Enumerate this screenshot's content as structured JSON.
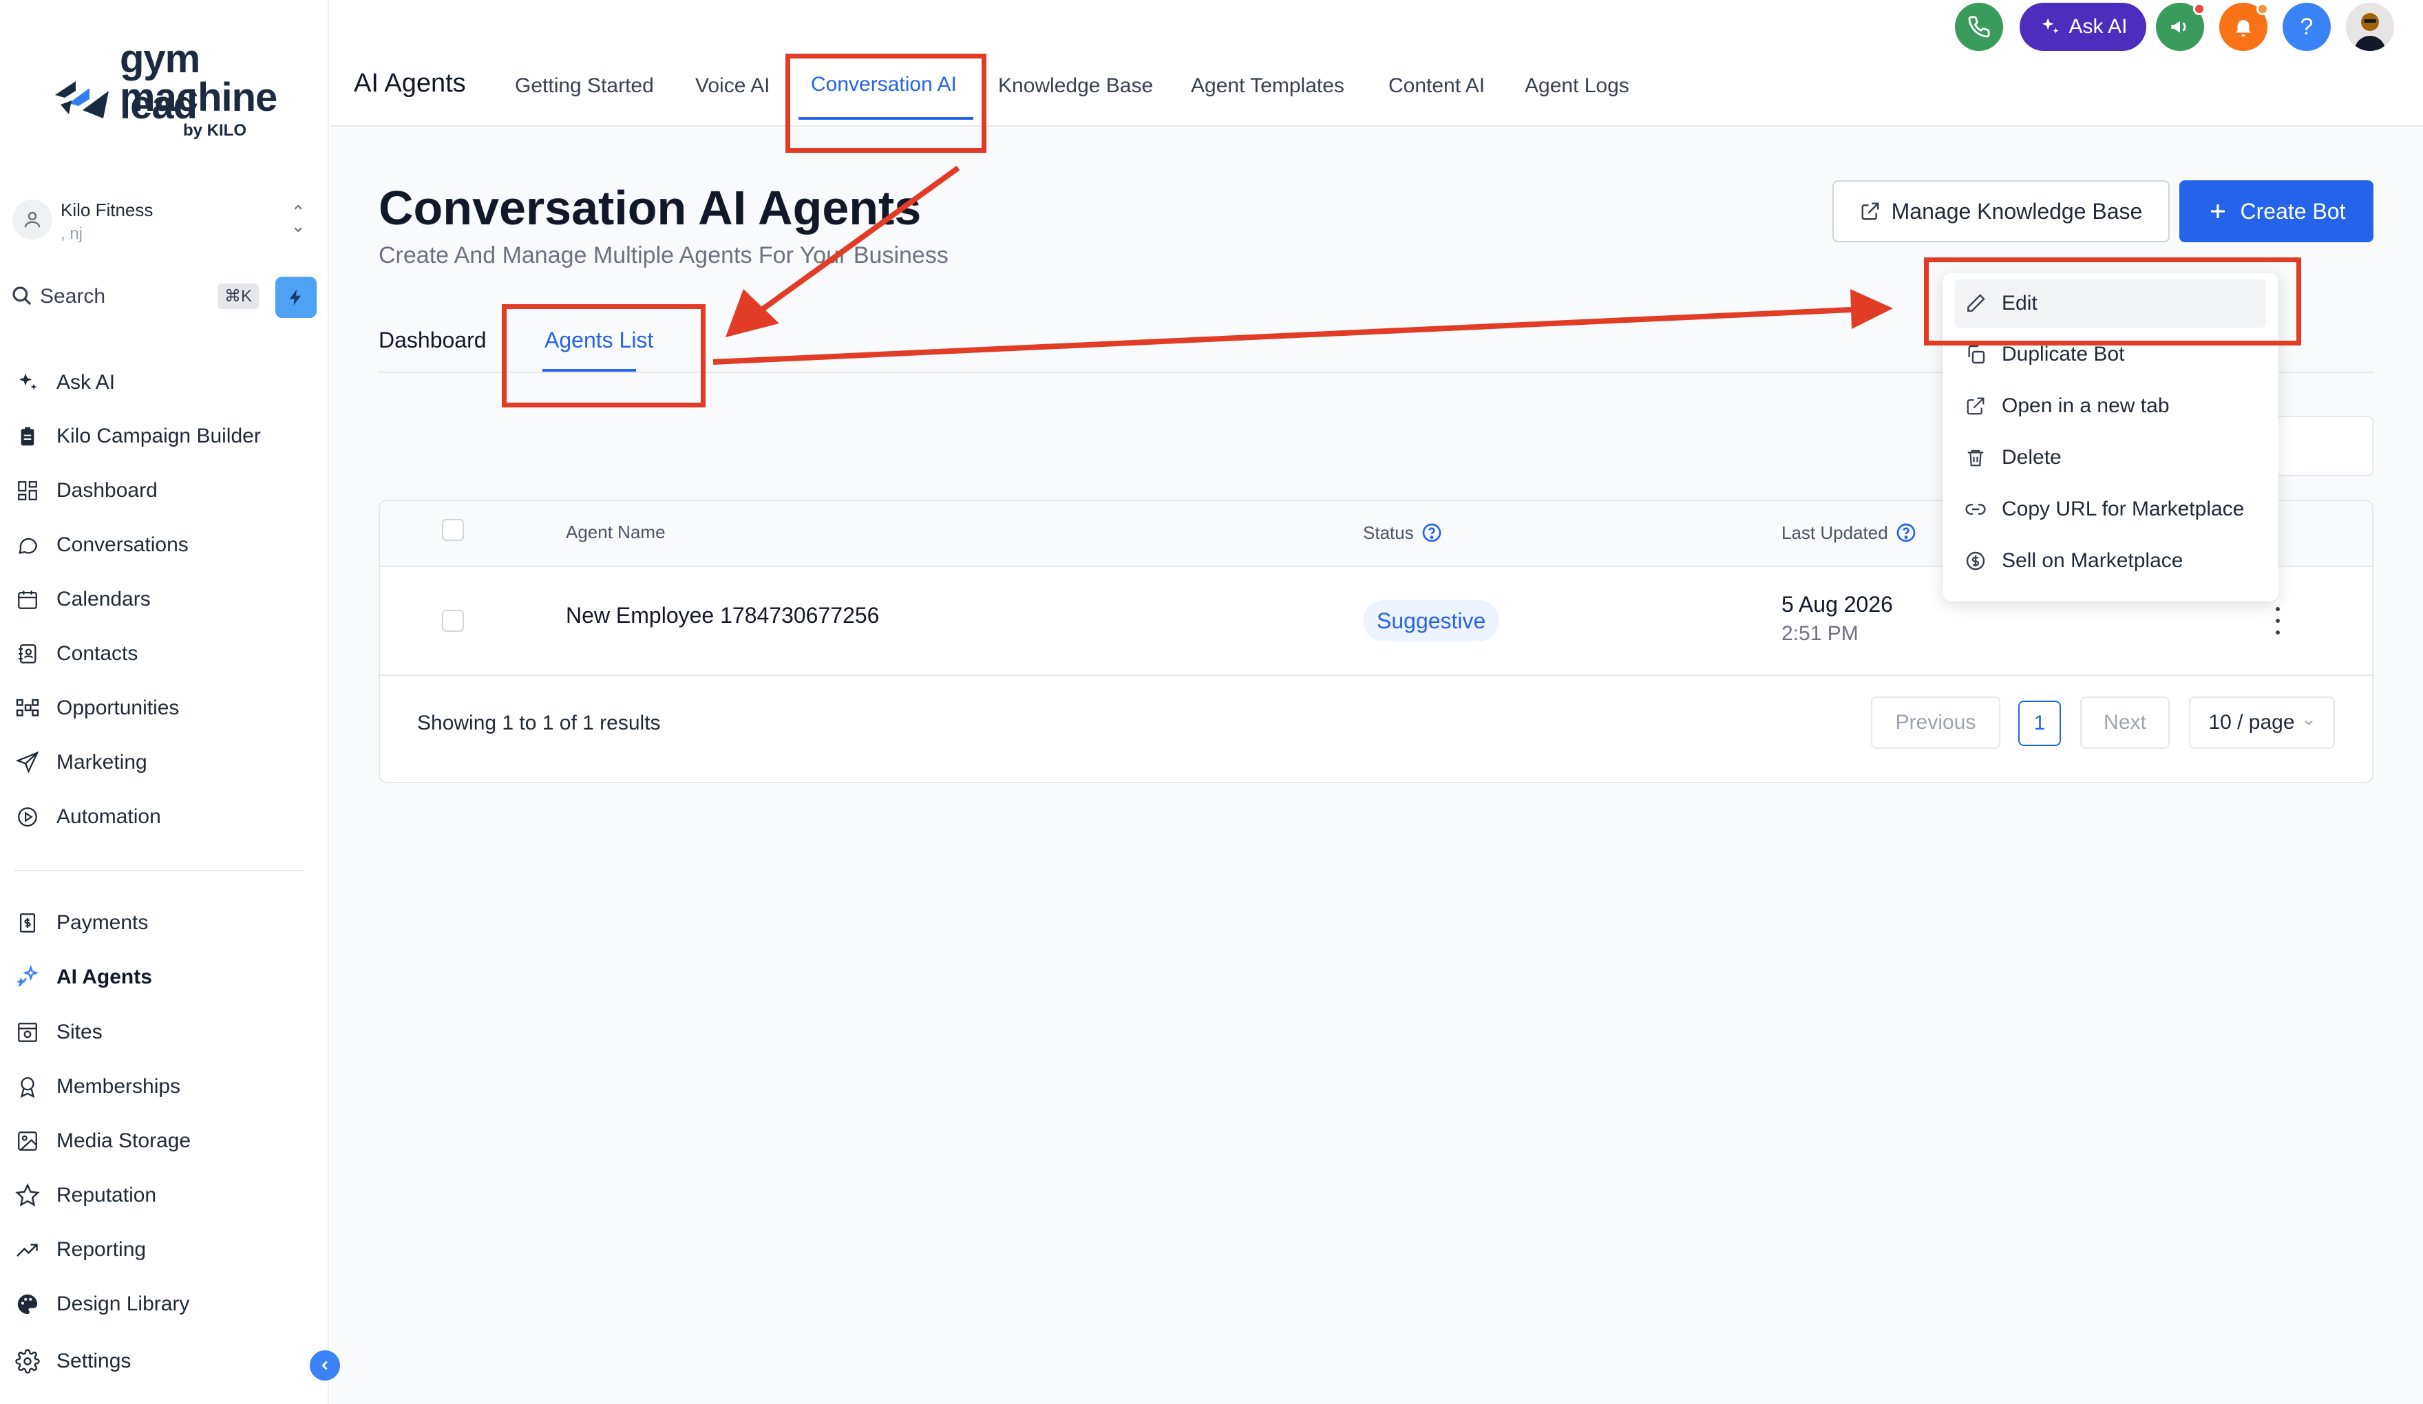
{
  "sidebar": {
    "logo": {
      "line1": "gym lead",
      "line2": "machine",
      "line3": "by KILO"
    },
    "account": {
      "name": "Kilo Fitness",
      "sub": ", nj"
    },
    "search": {
      "label": "Search",
      "shortcut": "⌘K"
    },
    "items": [
      {
        "label": "Ask AI",
        "icon": "sparkle-icon"
      },
      {
        "label": "Kilo Campaign Builder",
        "icon": "clipboard-icon"
      },
      {
        "label": "Dashboard",
        "icon": "grid-icon"
      },
      {
        "label": "Conversations",
        "icon": "chat-bubble-icon"
      },
      {
        "label": "Calendars",
        "icon": "calendar-icon"
      },
      {
        "label": "Contacts",
        "icon": "contacts-icon"
      },
      {
        "label": "Opportunities",
        "icon": "opportunities-icon"
      },
      {
        "label": "Marketing",
        "icon": "send-icon"
      },
      {
        "label": "Automation",
        "icon": "play-circle-icon"
      },
      {
        "label": "Payments",
        "icon": "receipt-icon"
      },
      {
        "label": "AI Agents",
        "icon": "sparkle-agents-icon"
      },
      {
        "label": "Sites",
        "icon": "sites-icon"
      },
      {
        "label": "Memberships",
        "icon": "award-icon"
      },
      {
        "label": "Media Storage",
        "icon": "image-icon"
      },
      {
        "label": "Reputation",
        "icon": "star-icon"
      },
      {
        "label": "Reporting",
        "icon": "trend-icon"
      },
      {
        "label": "Design Library",
        "icon": "palette-icon"
      },
      {
        "label": "Settings",
        "icon": "gear-icon"
      }
    ]
  },
  "topbar": {
    "app_title": "AI Agents",
    "tabs": [
      "Getting Started",
      "Voice AI",
      "Conversation AI",
      "Knowledge Base",
      "Agent Templates",
      "Content AI",
      "Agent Logs"
    ],
    "active_tab": "Conversation AI",
    "ask_ai_label": "Ask AI"
  },
  "main": {
    "title": "Conversation AI Agents",
    "subtitle": "Create And Manage Multiple Agents For Your Business",
    "manage_kb_label": "Manage Knowledge Base",
    "create_bot_label": "Create Bot",
    "sub_tabs": [
      "Dashboard",
      "Agents List"
    ],
    "active_sub_tab": "Agents List",
    "table": {
      "headers": {
        "agent_name": "Agent Name",
        "status": "Status",
        "last_updated": "Last Updated"
      },
      "rows": [
        {
          "agent_name": "New Employee 1784730677256",
          "status": "Suggestive",
          "date": "5 Aug 2026",
          "time": "2:51 PM"
        }
      ]
    },
    "pagination": {
      "showing": "Showing 1 to 1 of 1 results",
      "previous": "Previous",
      "page": "1",
      "next": "Next",
      "page_size": "10 / page"
    }
  },
  "dropdown": {
    "items": [
      {
        "label": "Edit",
        "icon": "pencil-icon"
      },
      {
        "label": "Duplicate Bot",
        "icon": "copy-icon"
      },
      {
        "label": "Open in a new tab",
        "icon": "external-link-icon"
      },
      {
        "label": "Delete",
        "icon": "trash-icon"
      },
      {
        "label": "Copy URL for Marketplace",
        "icon": "link-icon"
      },
      {
        "label": "Sell on Marketplace",
        "icon": "dollar-circle-icon"
      }
    ]
  },
  "colors": {
    "accent": "#2563eb",
    "annotation": "#e23b26",
    "ask_ai": "#4c2dbe",
    "phone": "#3a9b5c",
    "bell": "#f97316",
    "help": "#3b82f6"
  }
}
